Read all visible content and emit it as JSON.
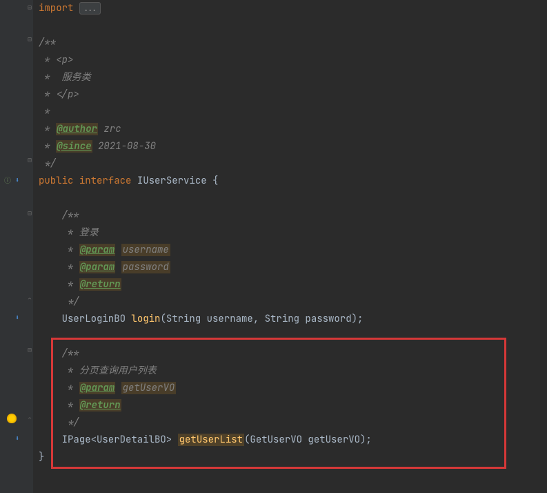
{
  "code": {
    "import_kw": "import",
    "fold_dots": "...",
    "doc1_open": "/**",
    "doc1_l1": " * <p>",
    "doc1_l2": " *  服务类",
    "doc1_l3": " * </p>",
    "doc1_l4": " *",
    "doc1_author_star": " * ",
    "doc1_author_tag": "@author",
    "doc1_author_val": " zrc",
    "doc1_since_star": " * ",
    "doc1_since_tag": "@since",
    "doc1_since_val": " 2021-08-30",
    "doc1_close": " */",
    "public_kw": "public",
    "interface_kw": "interface",
    "interface_name": "IUserService",
    "brace_open": " {",
    "doc2_open": "/**",
    "doc2_l1": " * 登录",
    "doc2_param_star": " * ",
    "doc2_param_tag": "@param",
    "doc2_param1": "username",
    "doc2_param2": "password",
    "doc2_return_star": " * ",
    "doc2_return_tag": "@return",
    "doc2_close": " */",
    "ret1": "UserLoginBO",
    "method1": "login",
    "sig1": "(String username, String password);",
    "doc3_open": "/**",
    "doc3_l1": " * 分页查询用户列表",
    "doc3_param_star": " * ",
    "doc3_param_tag": "@param",
    "doc3_param1": "getUserVO",
    "doc3_return_star": " * ",
    "doc3_return_tag": "@return",
    "doc3_close": " */",
    "ret2": "IPage<UserDetailBO>",
    "method2": "getUserList",
    "sig2": "(GetUserVO getUserVO);",
    "brace_close": "}"
  },
  "gutter": {
    "impl_icon": "⬇",
    "override_icon": "⬇"
  }
}
